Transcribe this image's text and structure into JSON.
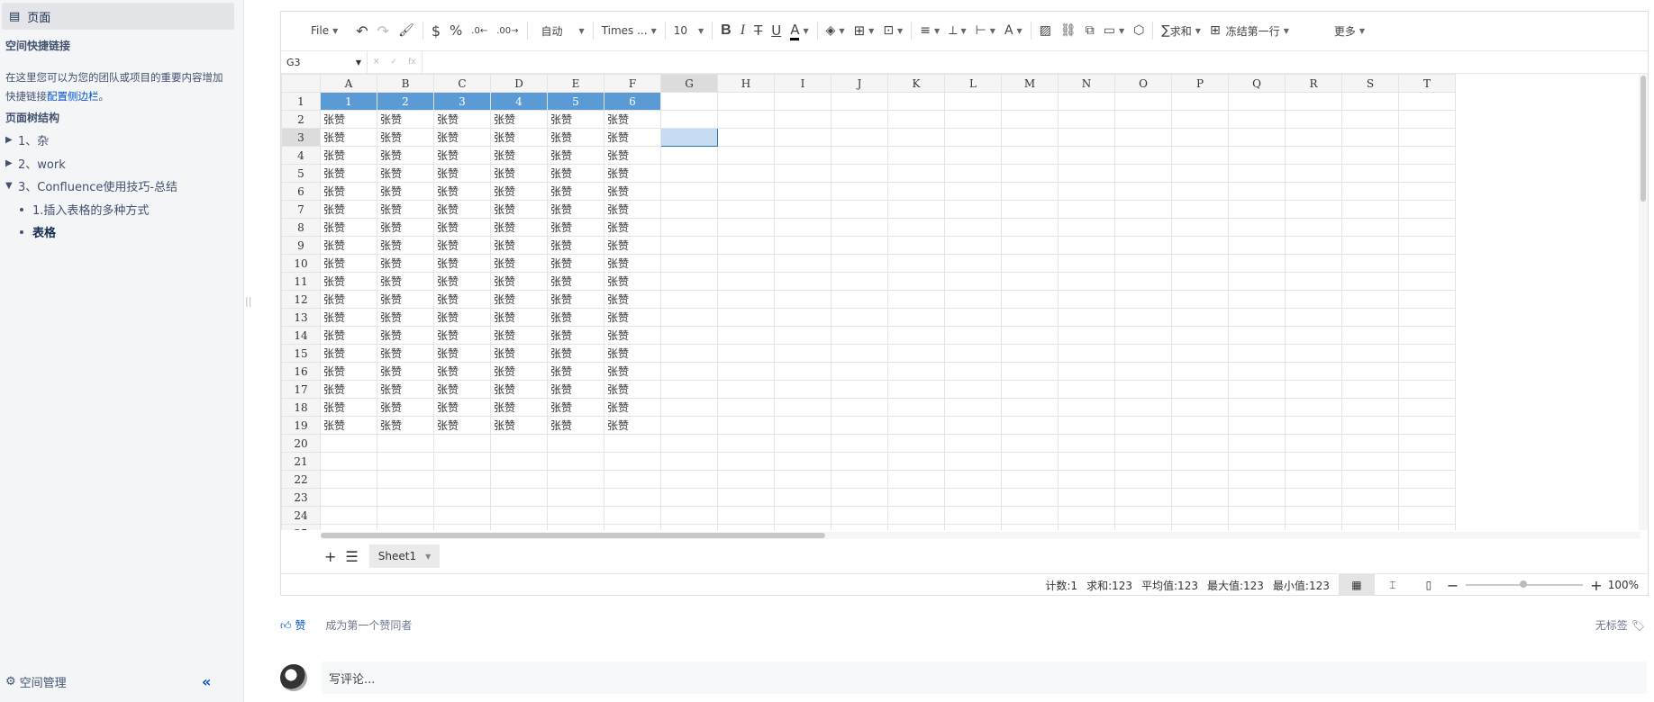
{
  "sidebar": {
    "top_label": "页面",
    "shortcut_heading": "空间快捷链接",
    "shortcut_text": "在这里您可以为您的团队或项目的重要内容增加快捷链接",
    "shortcut_link": "配置侧边栏",
    "shortcut_end": "。",
    "tree_heading": "页面树结构",
    "tree": [
      {
        "label": "1、杂",
        "type": "collapsed"
      },
      {
        "label": "2、work",
        "type": "collapsed"
      },
      {
        "label": "3、Confluence使用技巧-总结",
        "type": "expanded"
      },
      {
        "label": "1.插入表格的多种方式",
        "type": "bullet"
      },
      {
        "label": "表格",
        "type": "bullet-active"
      }
    ],
    "space_manage": "空间管理"
  },
  "toolbar": {
    "file": "File",
    "auto": "自动",
    "font": "Times ...",
    "size": "10",
    "sum": "求和",
    "freeze": "冻结第一行",
    "more": "更多"
  },
  "formula": {
    "cell_ref": "G3",
    "fx": "fx"
  },
  "grid": {
    "columns": [
      "A",
      "B",
      "C",
      "D",
      "E",
      "F",
      "G",
      "H",
      "I",
      "J",
      "K",
      "L",
      "M",
      "N",
      "O",
      "P",
      "Q",
      "R",
      "S",
      "T"
    ],
    "header_row": [
      "1",
      "2",
      "3",
      "4",
      "5",
      "6"
    ],
    "cell_text": "张赞",
    "data_rows": 18,
    "total_rows": 25,
    "selected_col": "G",
    "selected_row": 3
  },
  "tabs": {
    "sheet": "Sheet1"
  },
  "status": {
    "count": "计数:1",
    "sum": "求和:123",
    "avg": "平均值:123",
    "max": "最大值:123",
    "min": "最小值:123",
    "zoom": "100%"
  },
  "footer": {
    "like": "赞",
    "like_hint": "成为第一个赞同者",
    "no_tags": "无标签",
    "comment_placeholder": "写评论..."
  }
}
